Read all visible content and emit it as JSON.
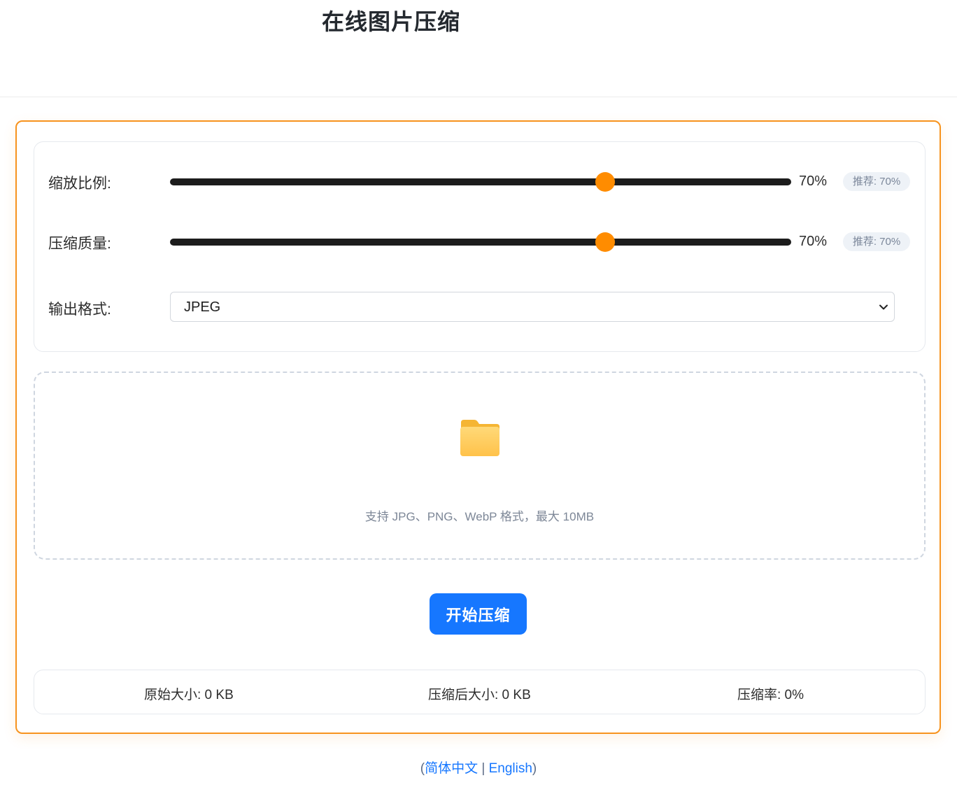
{
  "header": {
    "title": "在线图片压缩"
  },
  "settings": {
    "scale": {
      "label": "缩放比例:",
      "value": 70,
      "value_text": "70%",
      "recommend": "推荐: 70%"
    },
    "quality": {
      "label": "压缩质量:",
      "value": 70,
      "value_text": "70%",
      "recommend": "推荐: 70%"
    },
    "format": {
      "label": "输出格式:",
      "selected": "JPEG"
    }
  },
  "upload": {
    "icon": "folder-icon",
    "hint": "支持 JPG、PNG、WebP 格式，最大 10MB"
  },
  "actions": {
    "compress_label": "开始压缩"
  },
  "stats": {
    "original": "原始大小: 0 KB",
    "compressed": "压缩后大小: 0 KB",
    "ratio": "压缩率: 0%"
  },
  "footer": {
    "open_paren": "(",
    "lang_zh": "简体中文",
    "separator": " | ",
    "lang_en": "English",
    "close_paren": ")"
  },
  "colors": {
    "accent": "#ff8c00",
    "card_border": "#f7931e",
    "primary_button": "#1677ff",
    "slider_track": "#1c1c1c"
  }
}
